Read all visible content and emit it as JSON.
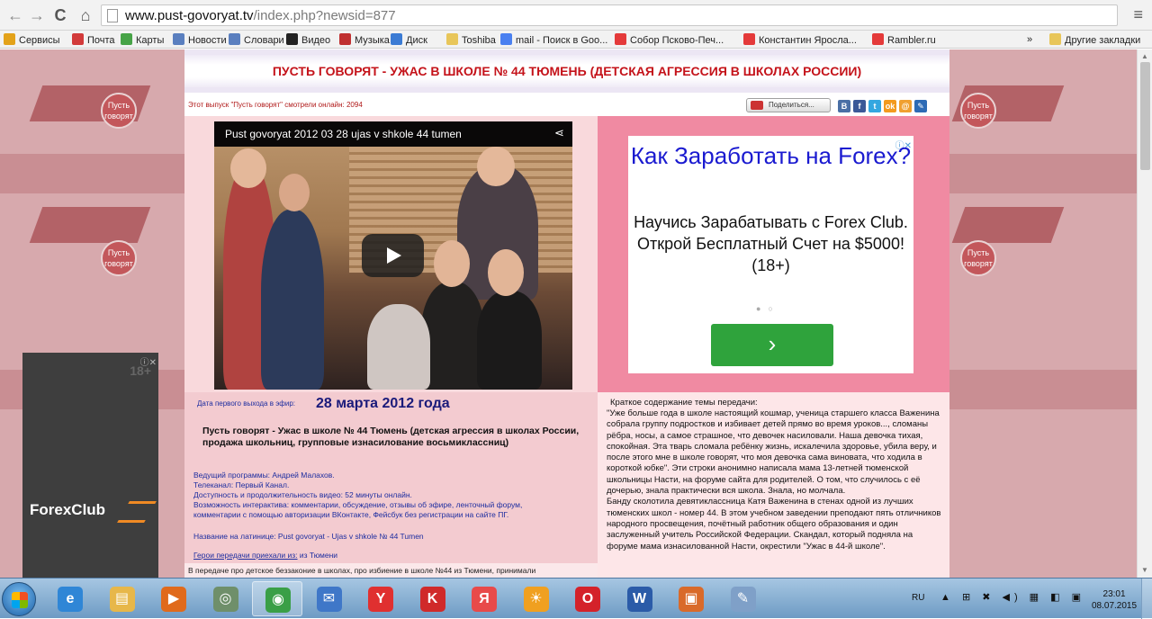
{
  "browser": {
    "url_host": "www.pust-govoryat.tv",
    "url_path": "/index.php?newsid=877",
    "menu_glyph": "≡",
    "back_glyph": "←",
    "forward_glyph": "→",
    "reload_glyph": "C",
    "home_glyph": "⌂"
  },
  "bookmarks": {
    "items": [
      {
        "label": "Сервисы",
        "icon": "apps-icon",
        "color": "#e3a21a"
      },
      {
        "label": "Почта",
        "icon": "mail-bookmark-icon",
        "color": "#d23a3a"
      },
      {
        "label": "Карты",
        "icon": "maps-bookmark-icon",
        "color": "#47a347"
      },
      {
        "label": "Новости",
        "icon": "page-bookmark-icon",
        "color": "#5a7fbf"
      },
      {
        "label": "Словари",
        "icon": "page-bookmark-icon",
        "color": "#5a7fbf"
      },
      {
        "label": "Видео",
        "icon": "video-bookmark-icon",
        "color": "#222222"
      },
      {
        "label": "Музыка",
        "icon": "music-bookmark-icon",
        "color": "#c03030"
      },
      {
        "label": "Диск",
        "icon": "disk-bookmark-icon",
        "color": "#3b7bd4"
      },
      {
        "label": "Toshiba",
        "icon": "folder-bookmark-icon",
        "color": "#e8c65a"
      },
      {
        "label": "mail - Поиск в Goo...",
        "icon": "google-bookmark-icon",
        "color": "#4a80f0"
      },
      {
        "label": "Собор Псково-Печ...",
        "icon": "yandex-bookmark-icon",
        "color": "#e43a3a"
      },
      {
        "label": "Константин Яросла...",
        "icon": "yandex-bookmark-icon",
        "color": "#e43a3a"
      },
      {
        "label": "Rambler.ru",
        "icon": "yandex-bookmark-icon",
        "color": "#e43a3a"
      }
    ],
    "overflow": "»",
    "other": "Другие закладки"
  },
  "page": {
    "title": "ПУСТЬ ГОВОРЯТ - УЖАС В ШКОЛЕ № 44 ТЮМЕНЬ (ДЕТСКАЯ АГРЕССИЯ В ШКОЛАХ РОССИИ)",
    "views_line": "Этот выпуск \"Пусть говорят\" смотрели онлайн: 2094",
    "share_label": "Поделиться...",
    "social": [
      {
        "label": "B",
        "color": "#4a6fa5"
      },
      {
        "label": "f",
        "color": "#3b5998"
      },
      {
        "label": "t",
        "color": "#33a7e0"
      },
      {
        "label": "ok",
        "color": "#f39a1e"
      },
      {
        "label": "@",
        "color": "#f0a030"
      },
      {
        "label": "✎",
        "color": "#2d6bb5"
      }
    ],
    "video": {
      "title": "Pust govoryat 2012 03 28 ujas v shkole 44 tumen",
      "share_glyph": "⋖"
    },
    "ad_right": {
      "choice": "ⓘ✕",
      "headline": "Как Заработать на Forex?",
      "body": "Научись Зарабатывать с Forex Club. Открой Бесплатный Счет на $5000! (18+)",
      "dots": "●○",
      "go_glyph": "›"
    },
    "info": {
      "date_label": "Дата первого выхода в эфир:",
      "date_value": "28 марта 2012 года",
      "headline": "Пусть говорят - Ужас в школе № 44 Тюмень (детская агрессия в школах России, продажа школьниц, групповые изнасилование восьмиклассниц)",
      "facts": [
        "Ведущий программы: Андрей Малахов.",
        "Телеканал: Первый Канал.",
        "Доступность и продолжительность видео: 52 минуты онлайн.",
        "Возможность интерактива: комментарии, обсуждение, отзывы об эфире, ленточный форум,",
        "комментарии с помощью авторизации ВКонтакте, Фейсбук без регистрации на сайте ПГ."
      ],
      "latin": "Название на латинице: Pust govoryat - Ujas v shkole № 44 Tumen",
      "guests_label": "Герои передачи приехали из:",
      "guests_value": " из Тюмени",
      "bottom": "В передаче про детское беззаконие в школах, про избиение в школе №44 из Тюмени, принимали"
    },
    "summary": {
      "head": "Краткое содержание темы передачи:",
      "text": "\"Уже больше года в школе настоящий кошмар, ученица старшего класса Важенина собрала группу подростков и избивает детей прямо во время уроков..., сломаны рёбра, носы, а самое страшное, что девочек насиловали. Наша девочка тихая, спокойная. Эта тварь сломала ребёнку жизнь, искалечила здоровье, убила веру, и после этого мне в школе говорят, что моя девочка сама виновата, что ходила в короткой юбке\". Эти строки анонимно написала мама 13-летней тюменской школьницы Насти, на форуме сайта для родителей. О том, что случилось с её дочерью, знала практически вся школа. Знала, но молчала.\nБанду сколотила девятиклассница Катя Важенина в стенах одной из лучших тюменских школ - номер 44. В этом учебном заведении преподают пять отличников народного просвещения, почётный работник общего образования и один заслуженный учитель Российской Федерации. Скандал, который подняла на форуме мама изнасилованной Насти, окрестили \"Ужас в 44-й школе\"."
    },
    "forex_ad": {
      "tag": "ⓘ✕",
      "age": "18+",
      "brand": "ForexClub"
    },
    "side_logo": "Пусть говорят"
  },
  "taskbar": {
    "apps": [
      {
        "name": "ie-icon",
        "glyph": "e",
        "color": "#2f86d6"
      },
      {
        "name": "explorer-icon",
        "glyph": "▤",
        "color": "#e7b74a"
      },
      {
        "name": "media-player-icon",
        "glyph": "▶",
        "color": "#e06a1c"
      },
      {
        "name": "app-circle-icon",
        "glyph": "◎",
        "color": "#6f8f6a"
      },
      {
        "name": "chrome-icon",
        "glyph": "◉",
        "color": "#3a9f47"
      },
      {
        "name": "mail-icon",
        "glyph": "✉",
        "color": "#3f77c8"
      },
      {
        "name": "yandex-browser-icon",
        "glyph": "Y",
        "color": "#e03030"
      },
      {
        "name": "kaspersky-icon",
        "glyph": "K",
        "color": "#d02a2a"
      },
      {
        "name": "yandex-icon",
        "glyph": "Я",
        "color": "#e84a4a"
      },
      {
        "name": "weather-icon",
        "glyph": "☀",
        "color": "#f0a020"
      },
      {
        "name": "opera-icon",
        "glyph": "O",
        "color": "#d4222a"
      },
      {
        "name": "word-icon",
        "glyph": "W",
        "color": "#2b5ba8"
      },
      {
        "name": "app-window-icon",
        "glyph": "▣",
        "color": "#d96a2a"
      },
      {
        "name": "paint-icon",
        "glyph": "✎",
        "color": "#7fa0c8"
      }
    ],
    "lang": "RU",
    "tray_glyphs": "▲ ⊞ ✖ ◀) ▦ ◧ ▣",
    "time": "23:01",
    "date": "08.07.2015"
  }
}
